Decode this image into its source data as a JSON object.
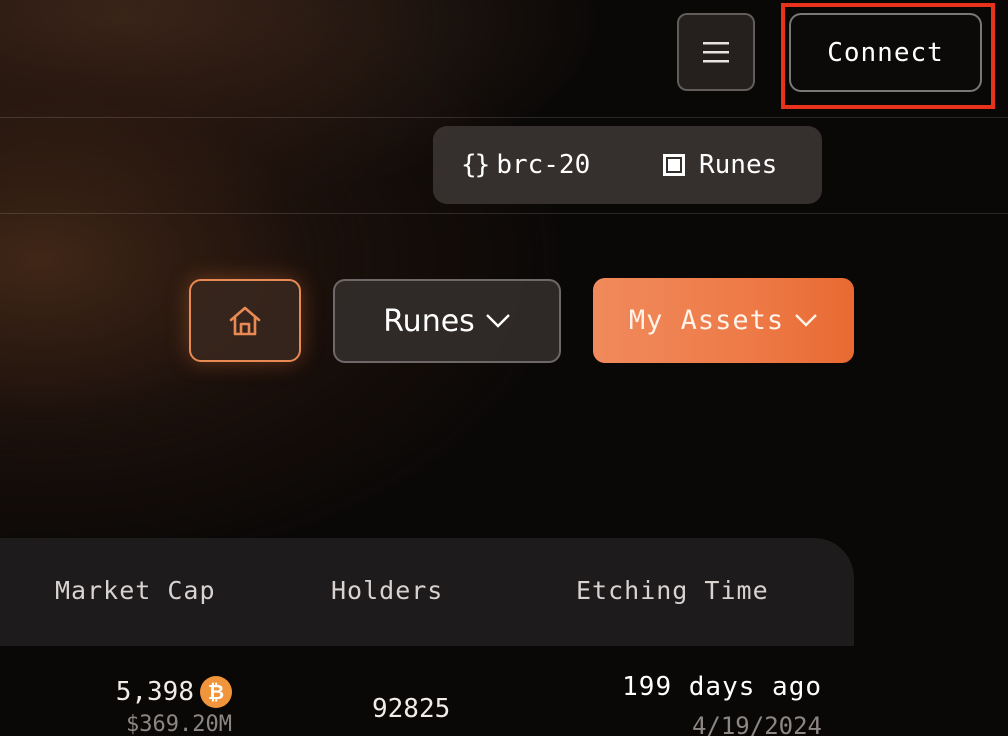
{
  "header": {
    "menu_icon": "hamburger-icon",
    "connect_label": "Connect"
  },
  "protocols": [
    {
      "icon": "braces-icon",
      "icon_text": "{}",
      "label": "brc-20"
    },
    {
      "icon": "square-icon",
      "label": "Runes"
    }
  ],
  "nav": {
    "home_icon": "home-icon",
    "runes_label": "Runes",
    "assets_label": "My Assets"
  },
  "table": {
    "columns": [
      "Market Cap",
      "Holders",
      "Etching Time"
    ],
    "rows": [
      {
        "market_cap_btc": "5,398",
        "market_cap_usd": "$369.20M",
        "holders": "92825",
        "etching_relative": "199 days ago",
        "etching_date": "4/19/2024"
      }
    ]
  },
  "colors": {
    "accent": "#ee7a47",
    "highlight": "#e8321c",
    "btc": "#f0953c"
  }
}
